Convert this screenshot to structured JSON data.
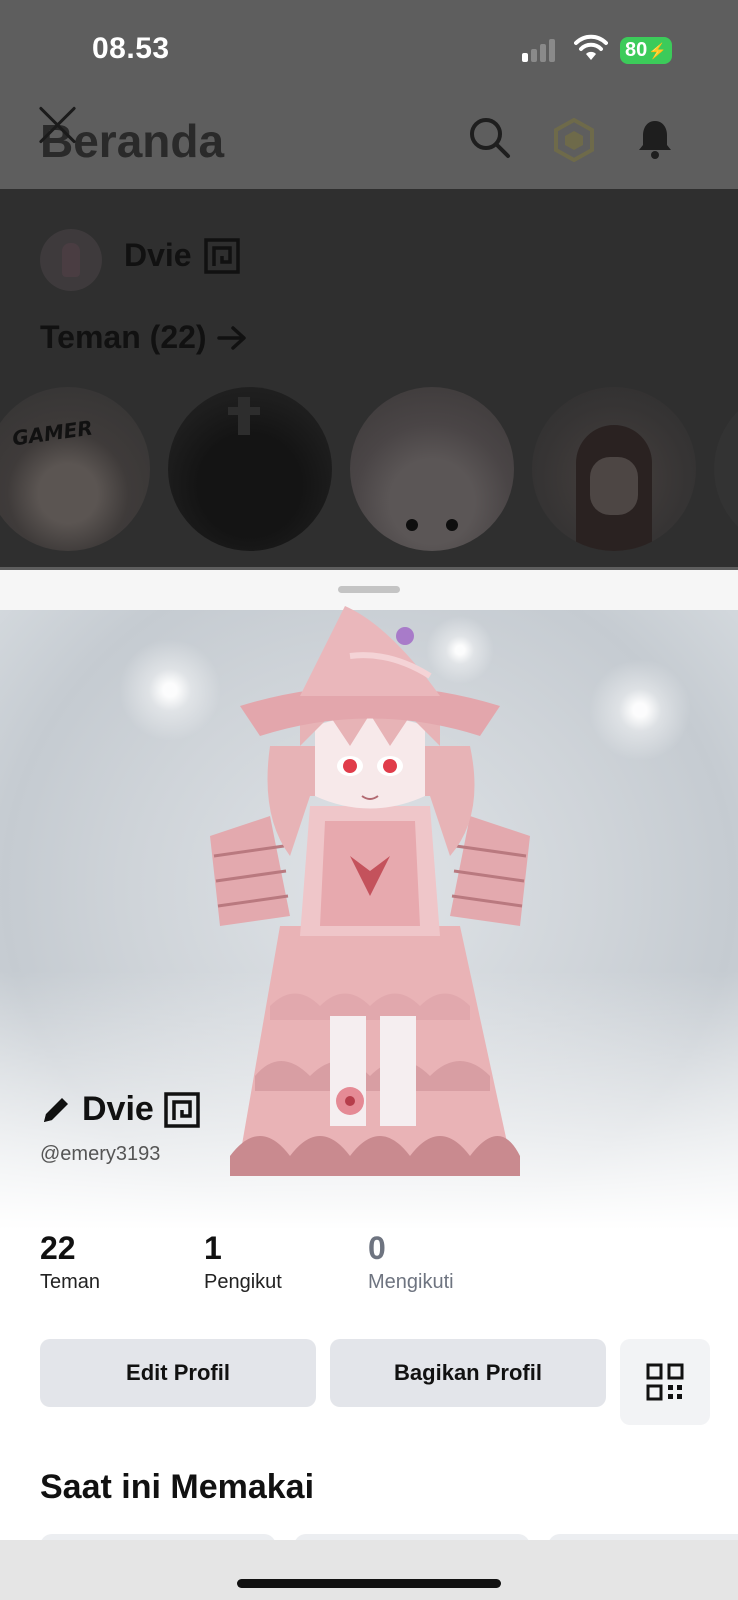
{
  "status_bar": {
    "time": "08.53",
    "battery": "80"
  },
  "header": {
    "title": "Beranda"
  },
  "background": {
    "user_name": "Dvie",
    "friends_heading": "Teman (22)",
    "friend_avatar_tag": "GAMER"
  },
  "profile": {
    "display_name": "Dvie",
    "username": "@emery3193",
    "stats": [
      {
        "value": "22",
        "label": "Teman"
      },
      {
        "value": "1",
        "label": "Pengikut"
      },
      {
        "value": "0",
        "label": "Mengikuti"
      }
    ],
    "buttons": {
      "edit": "Edit Profil",
      "share": "Bagikan Profil"
    },
    "section_wearing": "Saat ini Memakai"
  },
  "icons": {
    "close": "close-icon",
    "search": "search-icon",
    "robux": "robux-icon",
    "notifications": "bell-icon",
    "premium": "premium-icon",
    "edit": "pencil-icon",
    "qr": "qr-code-icon"
  },
  "colors": {
    "battery": "#3ccb5a",
    "button_bg": "#e3e5ea"
  }
}
